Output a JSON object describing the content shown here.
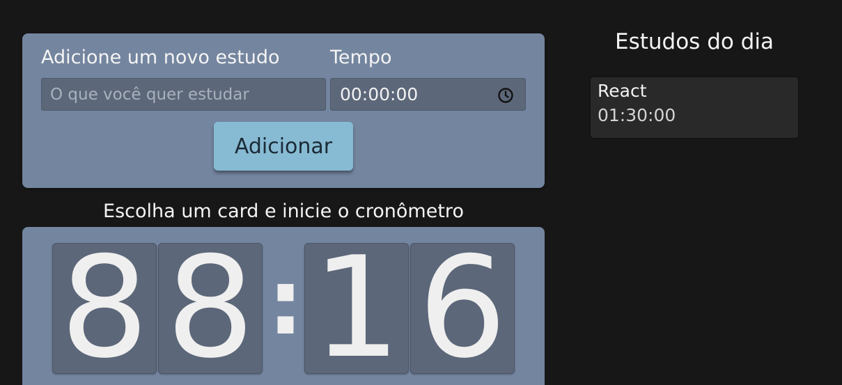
{
  "form": {
    "study_label": "Adicione um novo estudo",
    "time_label": "Tempo",
    "study_input": {
      "value": "",
      "placeholder": "O que você quer estudar"
    },
    "time_value": "00:00:00",
    "time_icon": "clock-icon",
    "submit_label": "Adicionar"
  },
  "timer": {
    "title": "Escolha um card e inicie o cronômetro",
    "digits": [
      "8",
      "8",
      "1",
      "6"
    ],
    "separator": ":"
  },
  "sidebar": {
    "title": "Estudos do dia",
    "items": [
      {
        "name": "React",
        "time": "01:30:00"
      }
    ]
  },
  "colors": {
    "background": "#171717",
    "card": "#74859f",
    "field": "#5c6779",
    "button": "#87bbd3",
    "list_item": "#292929"
  }
}
